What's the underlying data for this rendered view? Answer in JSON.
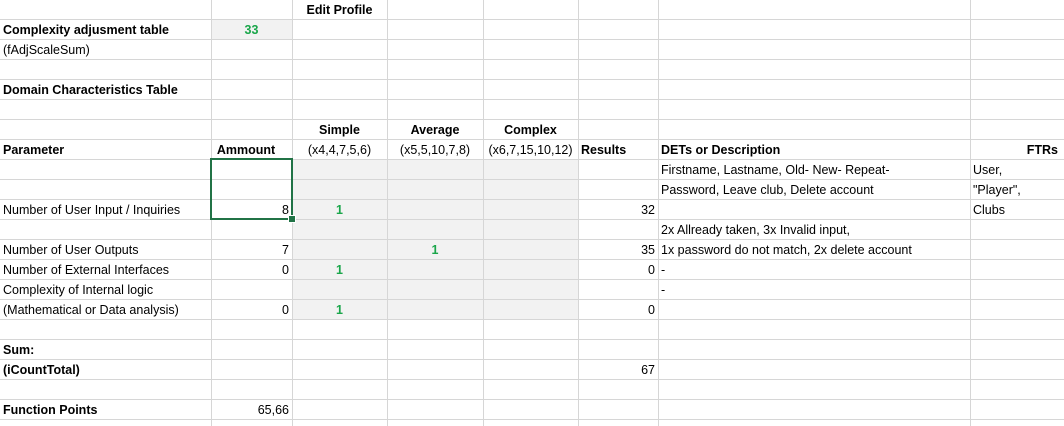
{
  "sheet": {
    "edit_profile": "Edit Profile",
    "complexity_label_line1": "Complexity adjusment table",
    "complexity_label_line2": "(fAdjScaleSum)",
    "complexity_value": "33",
    "domain_title": "Domain Characteristics Table",
    "headers": {
      "parameter": "Parameter",
      "ammount": "Ammount",
      "simple": "Simple",
      "simple_weights": "(x4,4,7,5,6)",
      "average": "Average",
      "average_weights": "(x5,5,10,7,8)",
      "complex": "Complex",
      "complex_weights": "(x6,7,15,10,12)",
      "results": "Results",
      "dets": "DETs or Description",
      "ftrs": "FTRs"
    },
    "rows": {
      "inputs": {
        "label": "Number of User Input / Inquiries",
        "amount": "8",
        "simple": "1",
        "result": "32",
        "desc_line1": "Firstname, Lastname, Old- New- Repeat-",
        "desc_line2": "Password, Leave club, Delete account",
        "ftr_line1": "User,",
        "ftr_line2": "\"Player\",",
        "ftr_line3": "Clubs"
      },
      "outputs": {
        "label": "Number of User Outputs",
        "amount": "7",
        "average": "1",
        "result": "35",
        "desc_line1": "2x Allready taken, 3x Invalid input,",
        "desc_line2": "1x password do not match, 2x delete account"
      },
      "interfaces": {
        "label": "Number of External Interfaces",
        "amount": "0",
        "simple": "1",
        "result": "0",
        "desc": "-"
      },
      "logic": {
        "label_line1": "Complexity of Internal logic",
        "label_line2": "(Mathematical or Data analysis)",
        "amount": "0",
        "simple": "1",
        "result": "0",
        "desc": "-"
      }
    },
    "sum_label_line1": "Sum:",
    "sum_label_line2": "(iCountTotal)",
    "sum_value": "67",
    "fp_label": "Function Points",
    "fp_value": "65,66"
  },
  "colors": {
    "gridline": "#d6d6d6",
    "shade": "#f2f2f2",
    "green_value": "#1aa64a",
    "selection": "#217346"
  }
}
